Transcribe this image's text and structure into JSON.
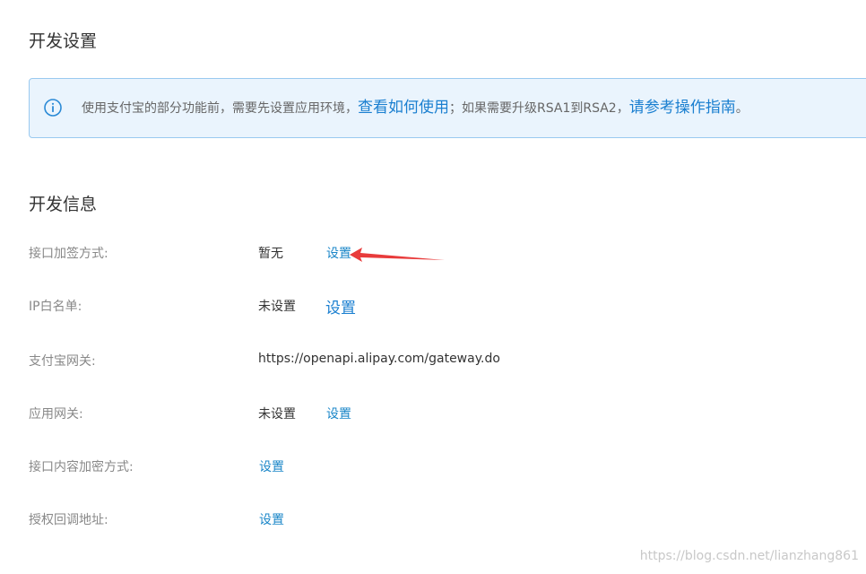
{
  "sections": {
    "dev_settings_title": "开发设置",
    "dev_info_title": "开发信息"
  },
  "notice": {
    "text_before": "使用支付宝的部分功能前，需要先设置应用环境，",
    "link1": "查看如何使用",
    "text_middle": "；如果需要升级RSA1到RSA2，",
    "link2": "请参考操作指南",
    "text_end": "。",
    "icon": "info-circle-icon",
    "colors": {
      "background": "#eaf4fd",
      "border": "#99c9f0",
      "link": "#1a7fd0"
    }
  },
  "rows": {
    "sign_method": {
      "label": "接口加签方式:",
      "value": "暂无",
      "action": "设置"
    },
    "ip_whitelist": {
      "label": "IP白名单:",
      "value": "未设置",
      "action": "设置"
    },
    "alipay_gateway": {
      "label": "支付宝网关:",
      "value": "https://openapi.alipay.com/gateway.do"
    },
    "app_gateway": {
      "label": "应用网关:",
      "value": "未设置",
      "action": "设置"
    },
    "content_encrypt": {
      "label": "接口内容加密方式:",
      "action": "设置"
    },
    "auth_callback": {
      "label": "授权回调地址:",
      "action": "设置"
    }
  },
  "annotation": {
    "arrow_color": "#e83b3b"
  },
  "watermark": "https://blog.csdn.net/lianzhang861"
}
